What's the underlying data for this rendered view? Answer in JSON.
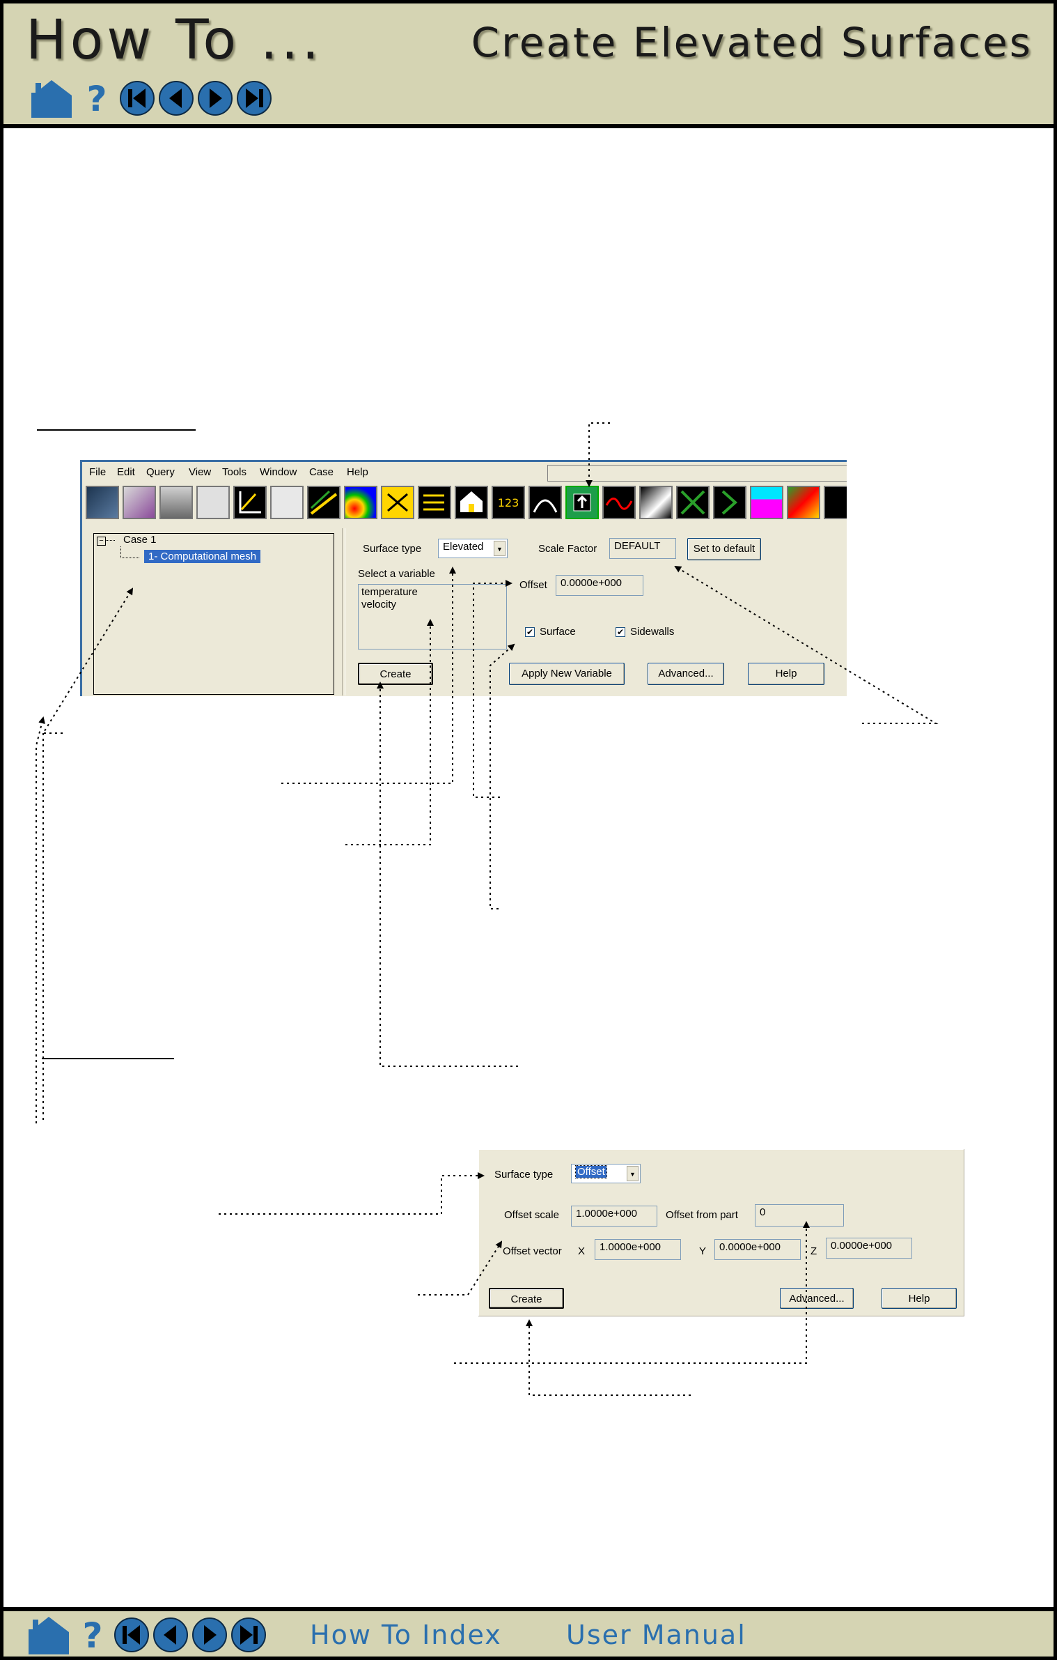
{
  "header": {
    "left_title": "How To ...",
    "right_title": "Create Elevated Surfaces",
    "nav_icons": [
      "home-icon",
      "help-icon",
      "first-page-icon",
      "previous-page-icon",
      "next-page-icon",
      "last-page-icon"
    ]
  },
  "screenshot1": {
    "menu": [
      "File",
      "Edit",
      "Query",
      "View",
      "Tools",
      "Window",
      "Case",
      "Help"
    ],
    "tree": {
      "case_label": "Case 1",
      "part_label": "1- Computational mesh"
    },
    "surface_type_label": "Surface type",
    "surface_type_value": "Elevated",
    "scale_factor_label": "Scale Factor",
    "scale_factor_value": "DEFAULT",
    "set_default_button": "Set to default",
    "select_variable_label": "Select a variable",
    "variables": [
      "temperature",
      "velocity"
    ],
    "offset_label": "Offset",
    "offset_value": "0.0000e+000",
    "surface_checkbox": "Surface",
    "sidewalls_checkbox": "Sidewalls",
    "create_button": "Create",
    "apply_new_variable_button": "Apply New Variable",
    "advanced_button": "Advanced...",
    "help_button": "Help"
  },
  "screenshot2": {
    "surface_type_label": "Surface type",
    "surface_type_value": "Offset",
    "offset_scale_label": "Offset scale",
    "offset_scale_value": "1.0000e+000",
    "offset_from_part_label": "Offset from part",
    "offset_from_part_value": "0",
    "offset_vector_label": "Offset vector",
    "x_label": "X",
    "x_value": "1.0000e+000",
    "y_label": "Y",
    "y_value": "0.0000e+000",
    "z_label": "Z",
    "z_value": "0.0000e+000",
    "create_button": "Create",
    "advanced_button": "Advanced...",
    "help_button": "Help"
  },
  "footer": {
    "nav_icons": [
      "home-icon",
      "help-icon",
      "first-page-icon",
      "previous-page-icon",
      "next-page-icon",
      "last-page-icon"
    ],
    "how_to_index_link": "How To Index",
    "user_manual_link": "User Manual"
  },
  "colors": {
    "band": "#d5d4b3",
    "nav_blue": "#2a6fae",
    "dialog_bg": "#ece9d8",
    "selection": "#316ac5"
  }
}
